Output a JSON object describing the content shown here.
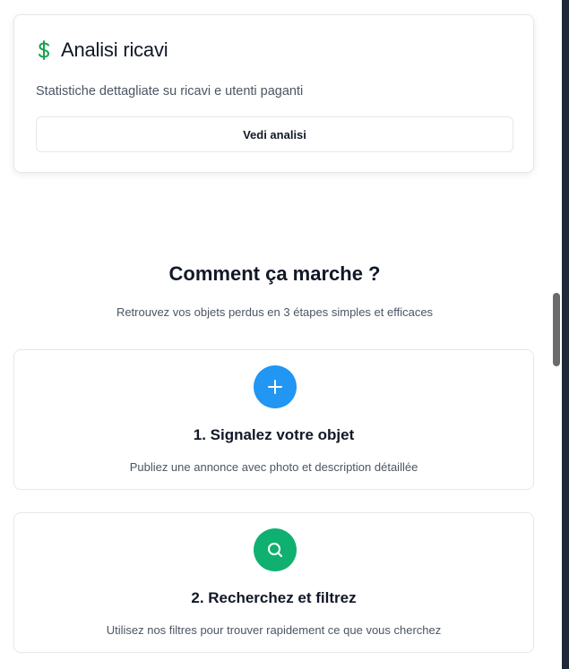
{
  "revenue_card": {
    "icon": "dollar-icon",
    "title": "Analisi ricavi",
    "description": "Statistiche dettagliate su ricavi e utenti paganti",
    "button_label": "Vedi analisi",
    "icon_color": "#16a34a"
  },
  "how_it_works": {
    "title": "Comment ça marche ?",
    "subtitle": "Retrouvez vos objets perdus en 3 étapes simples et efficaces",
    "steps": [
      {
        "icon": "plus-icon",
        "color": "#2196f3",
        "title": "1. Signalez votre objet",
        "description": "Publiez une annonce avec photo et description détaillée"
      },
      {
        "icon": "search-icon",
        "color": "#10b070",
        "title": "2. Recherchez et filtrez",
        "description": "Utilisez nos filtres pour trouver rapidement ce que vous cherchez"
      }
    ]
  }
}
